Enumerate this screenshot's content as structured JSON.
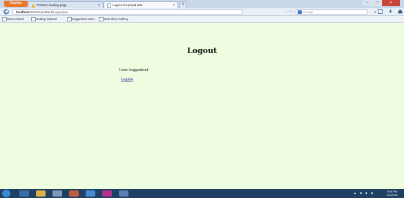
{
  "browser": {
    "app_button_label": "Firefox",
    "tabs": [
      {
        "label": "Problem loading page"
      },
      {
        "label": "Logout to Upload Site"
      }
    ],
    "tab_close_glyph": "×",
    "new_tab_glyph": "+",
    "window_controls": {
      "minimize": "–",
      "maximize": "□",
      "close": "✕"
    },
    "nav": {
      "back_glyph": "◀",
      "url_host": "localhost",
      "url_path": ":8080/SeedBank/Logout.jsp",
      "url_controls": "☆ ▾ C",
      "search_placeholder": "Google",
      "search_glyph": "⌕"
    },
    "bookmarks": [
      {
        "label": "Most Visited"
      },
      {
        "label": "Getting Started"
      },
      {
        "label": "Suggested Sites"
      },
      {
        "label": "Web Slice Gallery"
      }
    ]
  },
  "page": {
    "title": "Logout",
    "message": "User loggedout",
    "login_link": "Loginn"
  },
  "taskbar": {
    "tray_icons": "▲ ◆ ▮ ◀",
    "time": "9:35 PM",
    "date": "4/4/2015"
  },
  "colors": {
    "page_background": "#eefde0",
    "taskbar": "#1f3f63",
    "firefox_button": "#e8792a",
    "link": "#1a1a9a"
  }
}
